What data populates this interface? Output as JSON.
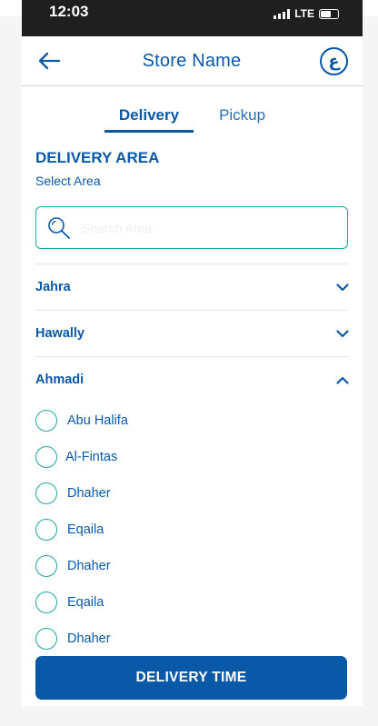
{
  "status_bar": {
    "time": "12:03",
    "network": "LTE"
  },
  "header": {
    "title": "Store Name",
    "lang_symbol": "ع"
  },
  "tabs": [
    {
      "label": "Delivery",
      "active": true
    },
    {
      "label": "Pickup",
      "active": false
    }
  ],
  "section": {
    "title": "DELIVERY AREA",
    "subtitle": "Select Area"
  },
  "search": {
    "placeholder": "Search Area ."
  },
  "regions": [
    {
      "name": "Jahra",
      "expanded": false
    },
    {
      "name": "Hawally",
      "expanded": false
    },
    {
      "name": "Ahmadi",
      "expanded": true
    }
  ],
  "areas": [
    "Abu Halifa",
    "Al-Fintas",
    "Dhaher",
    "Eqaila",
    "Dhaher",
    "Eqaila",
    "Dhaher"
  ],
  "cta": {
    "label": "DELIVERY TIME"
  },
  "colors": {
    "primary": "#0a58a8",
    "accent": "#1aa7a0",
    "statusbar": "#1f1f1f"
  }
}
